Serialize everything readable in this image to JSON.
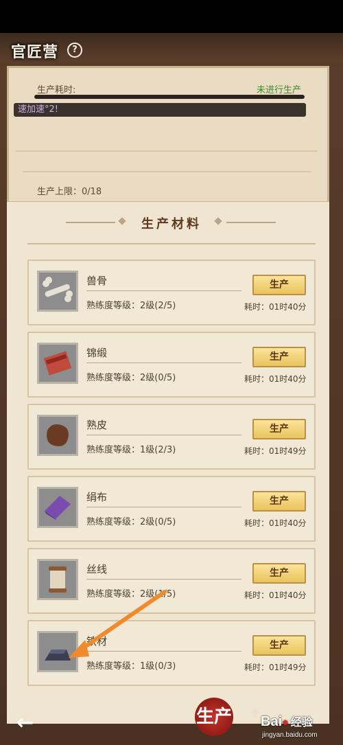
{
  "header": {
    "title": "官匠营",
    "help": "?"
  },
  "production": {
    "time_label": "生产耗时:",
    "status": "未进行生产",
    "speed_text": "速加速°2!",
    "limit_label": "生产上限：0/18"
  },
  "materials": {
    "section_title": "生产材料",
    "items": [
      {
        "name": "兽骨",
        "level": "熟练度等级：2级(2/5)",
        "button": "生产",
        "time": "耗时：01时40分"
      },
      {
        "name": "锦缎",
        "level": "熟练度等级：2级(0/5)",
        "button": "生产",
        "time": "耗时：01时40分"
      },
      {
        "name": "熟皮",
        "level": "熟练度等级：1级(2/3)",
        "button": "生产",
        "time": "耗时：01时49分"
      },
      {
        "name": "绢布",
        "level": "熟练度等级：2级(0/5)",
        "button": "生产",
        "time": "耗时：01时40分"
      },
      {
        "name": "丝线",
        "level": "熟练度等级：2级(1/5)",
        "button": "生产",
        "time": "耗时：01时40分"
      },
      {
        "name": "铁材",
        "level": "熟练度等级：1级(0/3)",
        "button": "生产",
        "time": "耗时：01时49分"
      }
    ]
  },
  "bottom": {
    "back": "←",
    "tab_produce": "生产"
  },
  "watermark": {
    "logo": "Bai",
    "logo2": "经验",
    "url": "jingyan.baidu.com"
  },
  "colors": {
    "button": "#e9c45c",
    "accent_green": "#3e8a2a",
    "annotation_arrow": "#f08a2c"
  }
}
